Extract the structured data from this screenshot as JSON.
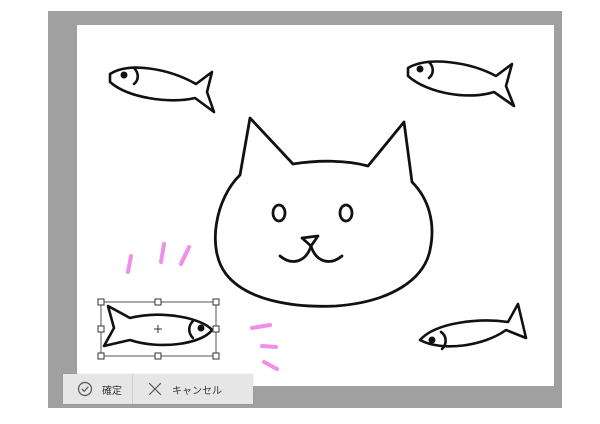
{
  "toolbar": {
    "confirm_label": "確定",
    "cancel_label": "キャンセル",
    "confirm_icon": "check-circle-icon",
    "cancel_icon": "close-icon"
  },
  "colors": {
    "workspace": "#a0a0a0",
    "paper": "#ffffff",
    "stroke": "#111111",
    "accent_marks": "#f08ee8",
    "toolbar_bg": "#e6e6e6"
  }
}
